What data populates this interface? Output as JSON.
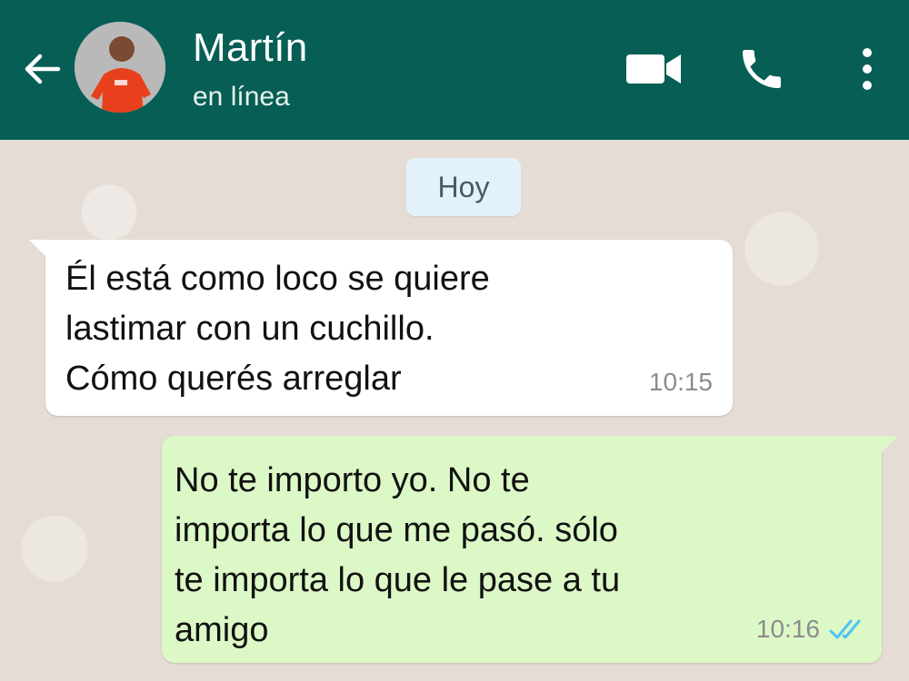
{
  "header": {
    "contact_name": "Martín",
    "status": "en línea",
    "icons": [
      "back-arrow-icon",
      "video-call-icon",
      "phone-icon",
      "more-options-icon"
    ],
    "bg_color": "#075e54"
  },
  "chat": {
    "date_label": "Hoy",
    "messages": [
      {
        "direction": "incoming",
        "text": "Él está como loco se quiere\nlastimar con un cuchillo.\nCómo querés arreglar",
        "time": "10:15"
      },
      {
        "direction": "outgoing",
        "text": "No te importo yo. No te\nimporta lo que me pasó. sólo\nte importa lo que le pase a tu\namigo",
        "time": "10:16",
        "read_status": "double-check-icon"
      }
    ],
    "colors": {
      "incoming_bubble": "#ffffff",
      "outgoing_bubble": "#dcf8c6",
      "read_ticks": "#4fc3f7"
    }
  }
}
